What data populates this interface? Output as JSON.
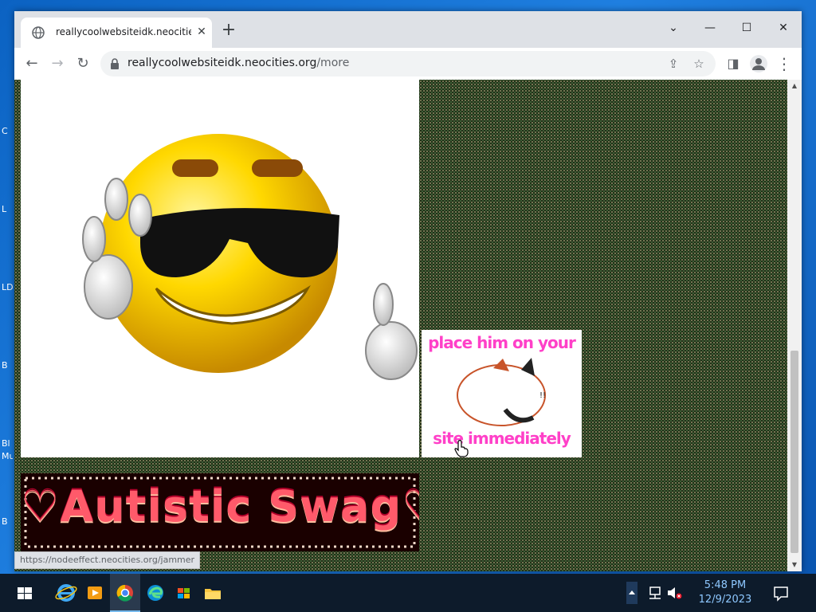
{
  "desktop": {
    "icon_labels": [
      "C",
      "L",
      "LD",
      "B",
      "Bl",
      "Mu",
      "B"
    ]
  },
  "browser": {
    "tab": {
      "title": "reallycoolwebsiteidk.neocities.org",
      "close": "✕"
    },
    "new_tab": "+",
    "window_controls": {
      "tab_search": "⌄",
      "minimize": "—",
      "maximize": "☐",
      "close": "✕"
    },
    "nav": {
      "back": "←",
      "forward": "→",
      "reload": "↻"
    },
    "address": {
      "host": "reallycoolwebsiteidk.neocities.org",
      "path": "/more"
    },
    "omnibox_actions": {
      "share": "⇪",
      "bookmark": "☆"
    },
    "toolbar": {
      "side_panel": "◨",
      "menu": "⋮"
    }
  },
  "page": {
    "cat_gif_top_text": "place him on your",
    "cat_gif_bottom_text": "site immediately",
    "banner_text": "♡Autistic Swag♡",
    "status_url": "https://nodeeffect.neocities.org/jammer"
  },
  "taskbar": {
    "time": "5:48 PM",
    "date": "12/9/2023"
  },
  "colors": {
    "desktop_blue": "#0a68c8",
    "taskbar": "#0d1b2b",
    "banner_pink": "#ff5a6a",
    "cat_text_magenta": "#ff40c8",
    "clock_text": "#8ec8ff"
  }
}
